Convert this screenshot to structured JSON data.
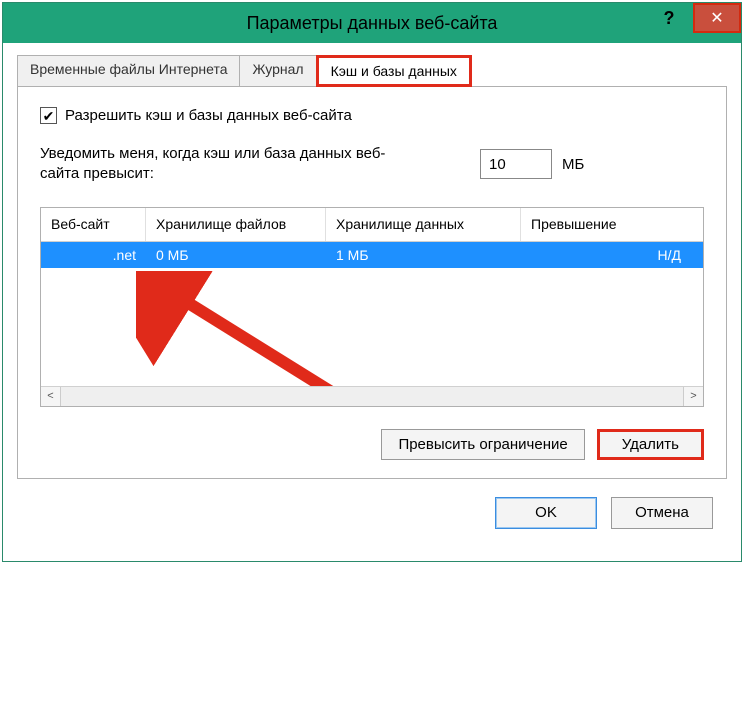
{
  "window": {
    "title": "Параметры данных веб-сайта",
    "help_symbol": "?",
    "close_symbol": "✕"
  },
  "tabs": [
    {
      "label": "Временные файлы Интернета",
      "active": false
    },
    {
      "label": "Журнал",
      "active": false
    },
    {
      "label": "Кэш и базы данных",
      "active": true
    }
  ],
  "panel": {
    "checkbox_label": "Разрешить кэш и базы данных веб-сайта",
    "checkbox_checked": true,
    "check_symbol": "✔",
    "notify_label": "Уведомить меня, когда кэш или база данных веб-сайта превысит:",
    "notify_value": "10",
    "notify_unit": "МБ",
    "columns": {
      "site": "Веб-сайт",
      "file_storage": "Хранилище файлов",
      "data_storage": "Хранилище данных",
      "exceed": "Превышение"
    },
    "rows": [
      {
        "site": ".net",
        "file_storage": "0 МБ",
        "data_storage": "1 МБ",
        "exceed": "Н/Д"
      }
    ],
    "scroll_left": "<",
    "scroll_right": ">",
    "buttons": {
      "exceed_limit": "Превысить ограничение",
      "delete": "Удалить"
    }
  },
  "footer": {
    "ok": "OK",
    "cancel": "Отмена"
  }
}
